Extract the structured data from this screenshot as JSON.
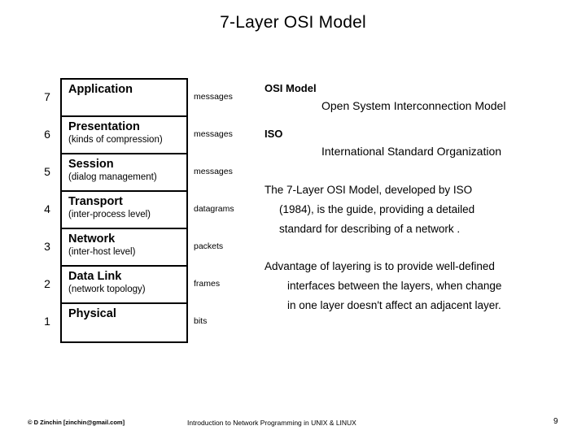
{
  "slide": {
    "title": "7-Layer OSI Model",
    "page_number": "9"
  },
  "layers": [
    {
      "number": "7",
      "name": "Application",
      "sub": "",
      "pdu": "messages"
    },
    {
      "number": "6",
      "name": "Presentation",
      "sub": "(kinds of compression)",
      "pdu": "messages"
    },
    {
      "number": "5",
      "name": "Session",
      "sub": "(dialog management)",
      "pdu": "messages"
    },
    {
      "number": "4",
      "name": "Transport",
      "sub": "(inter-process level)",
      "pdu": "datagrams"
    },
    {
      "number": "3",
      "name": "Network",
      "sub": "(inter-host level)",
      "pdu": "packets"
    },
    {
      "number": "2",
      "name": "Data Link",
      "sub": "(network topology)",
      "pdu": "frames"
    },
    {
      "number": "1",
      "name": "Physical",
      "sub": "",
      "pdu": "bits"
    }
  ],
  "notes": {
    "acronyms": [
      {
        "heading": "OSI Model",
        "expansion": "Open System Interconnection Model"
      },
      {
        "heading": "ISO",
        "expansion": "International Standard Organization"
      }
    ],
    "paragraph1": [
      "The 7-Layer OSI Model, developed by ISO",
      "(1984),  is the guide, providing a detailed",
      "standard for describing of a network ."
    ],
    "paragraph2": [
      "Advantage of layering is to provide well-defined",
      "interfaces between the layers, when change",
      "in one layer doesn't affect an adjacent layer."
    ]
  },
  "footer": {
    "copyright": "© D Zinchin [zinchin@gmail.com]",
    "center": "Introduction to Network Programming in UNIX & LINUX"
  }
}
